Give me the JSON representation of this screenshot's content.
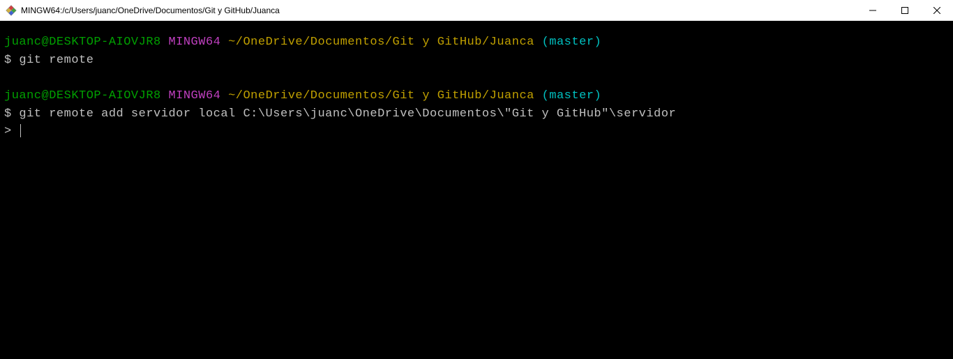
{
  "window": {
    "title": "MINGW64:/c/Users/juanc/OneDrive/Documentos/Git y GitHub/Juanca"
  },
  "prompt": {
    "user_host": "juanc@DESKTOP-AIOVJR8",
    "env": "MINGW64",
    "path": "~/OneDrive/Documentos/Git y GitHub/Juanca",
    "branch": "(master)",
    "symbol": "$",
    "continuation": ">"
  },
  "lines": {
    "cmd1": "git remote",
    "cmd2": "git remote add servidor local C:\\Users\\juanc\\OneDrive\\Documentos\\\"Git y GitHub\"\\servidor"
  }
}
